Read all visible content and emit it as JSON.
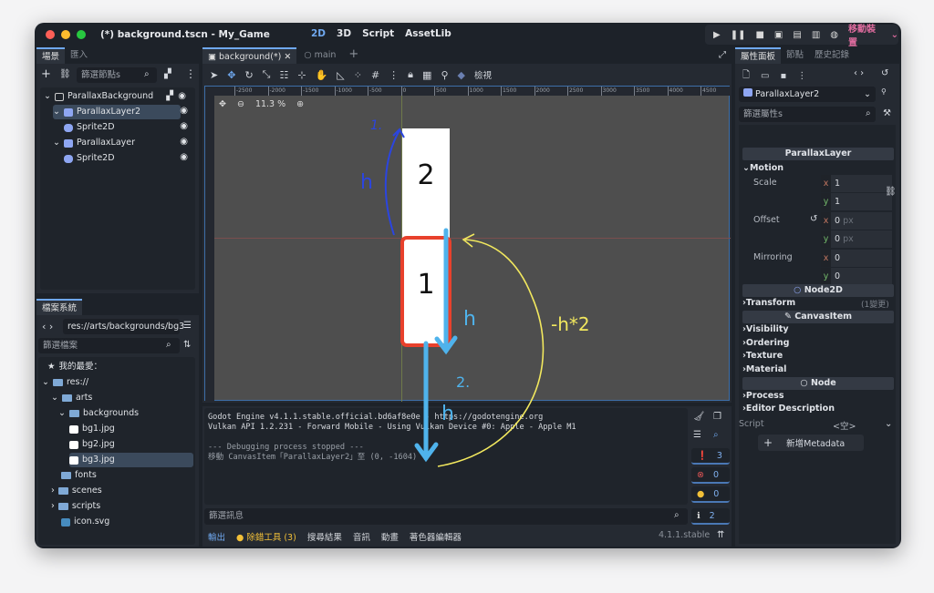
{
  "window": {
    "title": "(*) background.tscn - My_Game",
    "colors": {
      "close": "#fe5f57",
      "min": "#febc2e",
      "max": "#28c840",
      "accent": "#6fa8ef"
    }
  },
  "workspaces": [
    {
      "label": "2D",
      "active": true
    },
    {
      "label": "3D"
    },
    {
      "label": "Script"
    },
    {
      "label": "AssetLib"
    }
  ],
  "run_bar": {
    "icons": [
      "play-icon",
      "pause-icon",
      "stop-icon",
      "remote-debug-icon",
      "run-current-icon",
      "run-custom-icon",
      "movie-icon"
    ],
    "device": "移動裝置"
  },
  "scene_dock": {
    "tabs": [
      "場景",
      "匯入"
    ],
    "filter_placeholder": "篩選節點s",
    "tree": [
      {
        "label": "ParallaxBackground",
        "depth": 0
      },
      {
        "label": "ParallaxLayer2",
        "depth": 1,
        "selected": true
      },
      {
        "label": "Sprite2D",
        "depth": 2
      },
      {
        "label": "ParallaxLayer",
        "depth": 1
      },
      {
        "label": "Sprite2D",
        "depth": 2
      }
    ]
  },
  "filesystem": {
    "tab": "檔案系統",
    "path": "res://arts/backgrounds/bg3",
    "filter_placeholder": "篩選檔案",
    "items": [
      {
        "label": "我的最愛：",
        "type": "favorites"
      },
      {
        "label": "res://",
        "type": "folder"
      },
      {
        "label": "arts",
        "type": "folder"
      },
      {
        "label": "backgrounds",
        "type": "folder"
      },
      {
        "label": "bg1.jpg",
        "type": "image"
      },
      {
        "label": "bg2.jpg",
        "type": "image"
      },
      {
        "label": "bg3.jpg",
        "type": "image",
        "selected": true
      },
      {
        "label": "fonts",
        "type": "folder"
      },
      {
        "label": "scenes",
        "type": "folder"
      },
      {
        "label": "scripts",
        "type": "folder"
      },
      {
        "label": "icon.svg",
        "type": "godot"
      }
    ]
  },
  "editor": {
    "tabs": [
      {
        "label": "background(*)",
        "active": true
      },
      {
        "label": "main"
      }
    ],
    "view_menu": "檢視",
    "zoom": "11.3 %",
    "ruler": [
      "-2500",
      "-2000",
      "-1500",
      "-1000",
      "-500",
      "0",
      "500",
      "1000",
      "1500",
      "2000",
      "2500",
      "3000",
      "3500",
      "4000",
      "4500"
    ],
    "sprite_labels": [
      "2",
      "1"
    ],
    "annotations": {
      "a1": "1.",
      "a2": "h",
      "a3": "h",
      "a4": "2.",
      "a5": "h",
      "a6": "-h*2"
    }
  },
  "output": {
    "lines": [
      "Godot Engine v4.1.1.stable.official.bd6af8e0e - https://godotengine.org",
      "Vulkan API 1.2.231 - Forward Mobile - Using Vulkan Device #0: Apple - Apple M1",
      "",
      "--- Debugging process stopped ---",
      "移動 CanvasItem「ParallaxLayer2」至 (0, -1604)"
    ],
    "filter_placeholder": "篩選訊息",
    "counts": {
      "messages": "3",
      "errors": "0",
      "warnings": "0",
      "info": "2"
    }
  },
  "bottom_tabs": [
    {
      "label": "輸出",
      "active": true
    },
    {
      "label": "除錯工具 (3)",
      "dot": true
    },
    {
      "label": "搜尋結果"
    },
    {
      "label": "音訊"
    },
    {
      "label": "動畫"
    },
    {
      "label": "著色器編輯器"
    }
  ],
  "version": "4.1.1.stable",
  "inspector": {
    "tabs": [
      "屬性面板",
      "節點",
      "歷史記錄"
    ],
    "node": "ParallaxLayer2",
    "filter_placeholder": "篩選屬性s",
    "class_parallax": "ParallaxLayer",
    "motion": "Motion",
    "scale": {
      "label": "Scale",
      "x": "1",
      "y": "1"
    },
    "offset": {
      "label": "Offset",
      "x": "0",
      "y": "0",
      "unit": "px"
    },
    "mirroring": {
      "label": "Mirroring",
      "x": "0",
      "y": "0"
    },
    "class_node2d": "Node2D",
    "transform": "Transform",
    "transform_changes": "(1變更)",
    "class_canvas": "CanvasItem",
    "visibility": "Visibility",
    "ordering": "Ordering",
    "texture": "Texture",
    "material": "Material",
    "class_node": "Node",
    "process": "Process",
    "editor_description": "Editor Description",
    "script_label": "Script",
    "script_value": "<空>",
    "add_metadata": "新增Metadata"
  }
}
